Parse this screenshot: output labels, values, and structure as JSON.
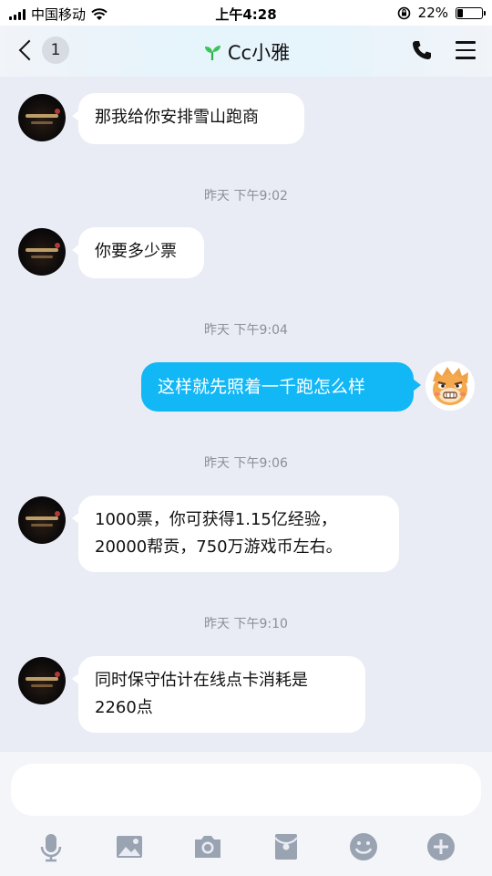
{
  "status_bar": {
    "carrier": "中国移动",
    "time": "上午4:28",
    "battery_percent": "22%",
    "battery_level": 0.22
  },
  "nav": {
    "back_badge": "1",
    "title": "Cc小雅"
  },
  "messages": [
    {
      "side": "left",
      "text": "那我给你安排雪山跑商"
    },
    {
      "timestamp": "昨天 下午9:02"
    },
    {
      "side": "left",
      "text": "你要多少票"
    },
    {
      "timestamp": "昨天 下午9:04"
    },
    {
      "side": "right",
      "text": "这样就先照着一千跑怎么样"
    },
    {
      "timestamp": "昨天 下午9:06"
    },
    {
      "side": "left",
      "text_lines": [
        "1000票，你可获得1.15亿经验，",
        "20000帮贡，750万游戏币左右。"
      ]
    },
    {
      "timestamp": "昨天 下午9:10"
    },
    {
      "side": "left",
      "text_lines": [
        "同时保守估计在线点卡消耗是",
        "2260点"
      ]
    }
  ],
  "input": {
    "value": "",
    "placeholder": ""
  },
  "toolbar": [
    "mic-icon",
    "image-icon",
    "camera-icon",
    "red-packet-icon",
    "emoji-icon",
    "plus-icon"
  ],
  "colors": {
    "accent": "#12b7f5",
    "background": "#e9ecf4",
    "icon": "#9aa3b2"
  }
}
